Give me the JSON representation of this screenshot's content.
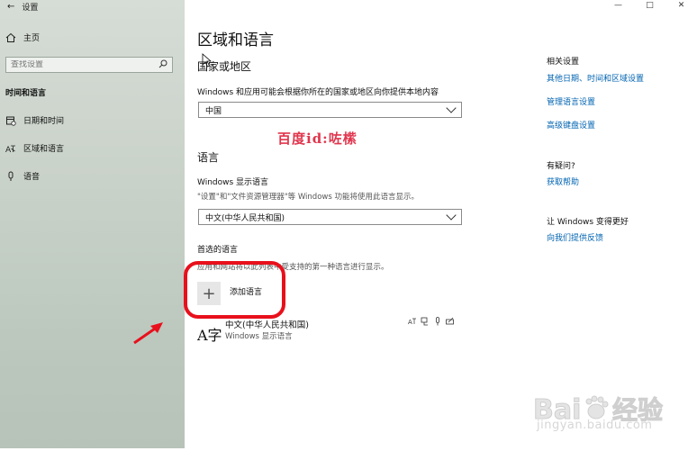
{
  "window": {
    "title": "设置",
    "back": "←",
    "minimize": "—",
    "maximize": "□",
    "close": "✕"
  },
  "sidebar": {
    "home": "主页",
    "search_placeholder": "查找设置",
    "section": "时间和语言",
    "items": [
      {
        "label": "日期和时间",
        "icon": "calendar-clock-icon"
      },
      {
        "label": "区域和语言",
        "icon": "language-icon"
      },
      {
        "label": "语音",
        "icon": "microphone-icon"
      }
    ]
  },
  "main": {
    "title": "区域和语言",
    "region": {
      "heading": "国家或地区",
      "description": "Windows 和应用可能会根据你所在的国家或地区向你提供本地内容",
      "value": "中国"
    },
    "watermark": "百度id:咗橴",
    "language": {
      "heading": "语言",
      "display_label": "Windows 显示语言",
      "display_desc": "\"设置\"和\"文件资源管理器\"等 Windows 功能将使用此语言显示。",
      "display_value": "中文(中华人民共和国)",
      "preferred_label": "首选的语言",
      "preferred_desc": "应用和网站将以此列表中受支持的第一种语言进行显示。",
      "add_label": "添加语言",
      "list": [
        {
          "name": "中文(中华人民共和国)",
          "sub": "Windows 显示语言",
          "icon": "A字"
        }
      ]
    }
  },
  "related": {
    "heading": "相关设置",
    "links": [
      "其他日期、时间和区域设置",
      "管理语言设置",
      "高级键盘设置"
    ],
    "question_heading": "有疑问?",
    "question_link": "获取帮助",
    "feedback_heading": "让 Windows 变得更好",
    "feedback_link": "向我们提供反馈"
  },
  "branding": {
    "logo": "Baidu经验",
    "url": "jingyan.baidu.com"
  }
}
